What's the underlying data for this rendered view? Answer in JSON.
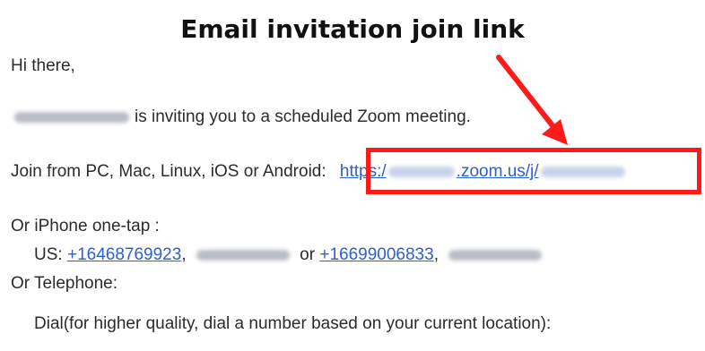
{
  "title": "Email invitation join link",
  "email": {
    "greeting": "Hi there,",
    "invite_text": "is inviting you to a scheduled Zoom meeting.",
    "join_label": "Join from PC, Mac, Linux, iOS or Android:",
    "join_link_prefix": "https:/",
    "join_link_mid": ".zoom.us/j/",
    "iphone_label": "Or iPhone one-tap :",
    "us_label": "US:",
    "phone_1": "+16468769923",
    "comma_1": ",",
    "or_text": "or",
    "phone_2": "+16699006833",
    "comma_2": ",",
    "telephone_label": "Or Telephone:",
    "dial_text": "Dial(for higher quality, dial a number based on your current location):"
  },
  "colors": {
    "highlight": "#ff1a1a",
    "link": "#2c5fd0"
  }
}
